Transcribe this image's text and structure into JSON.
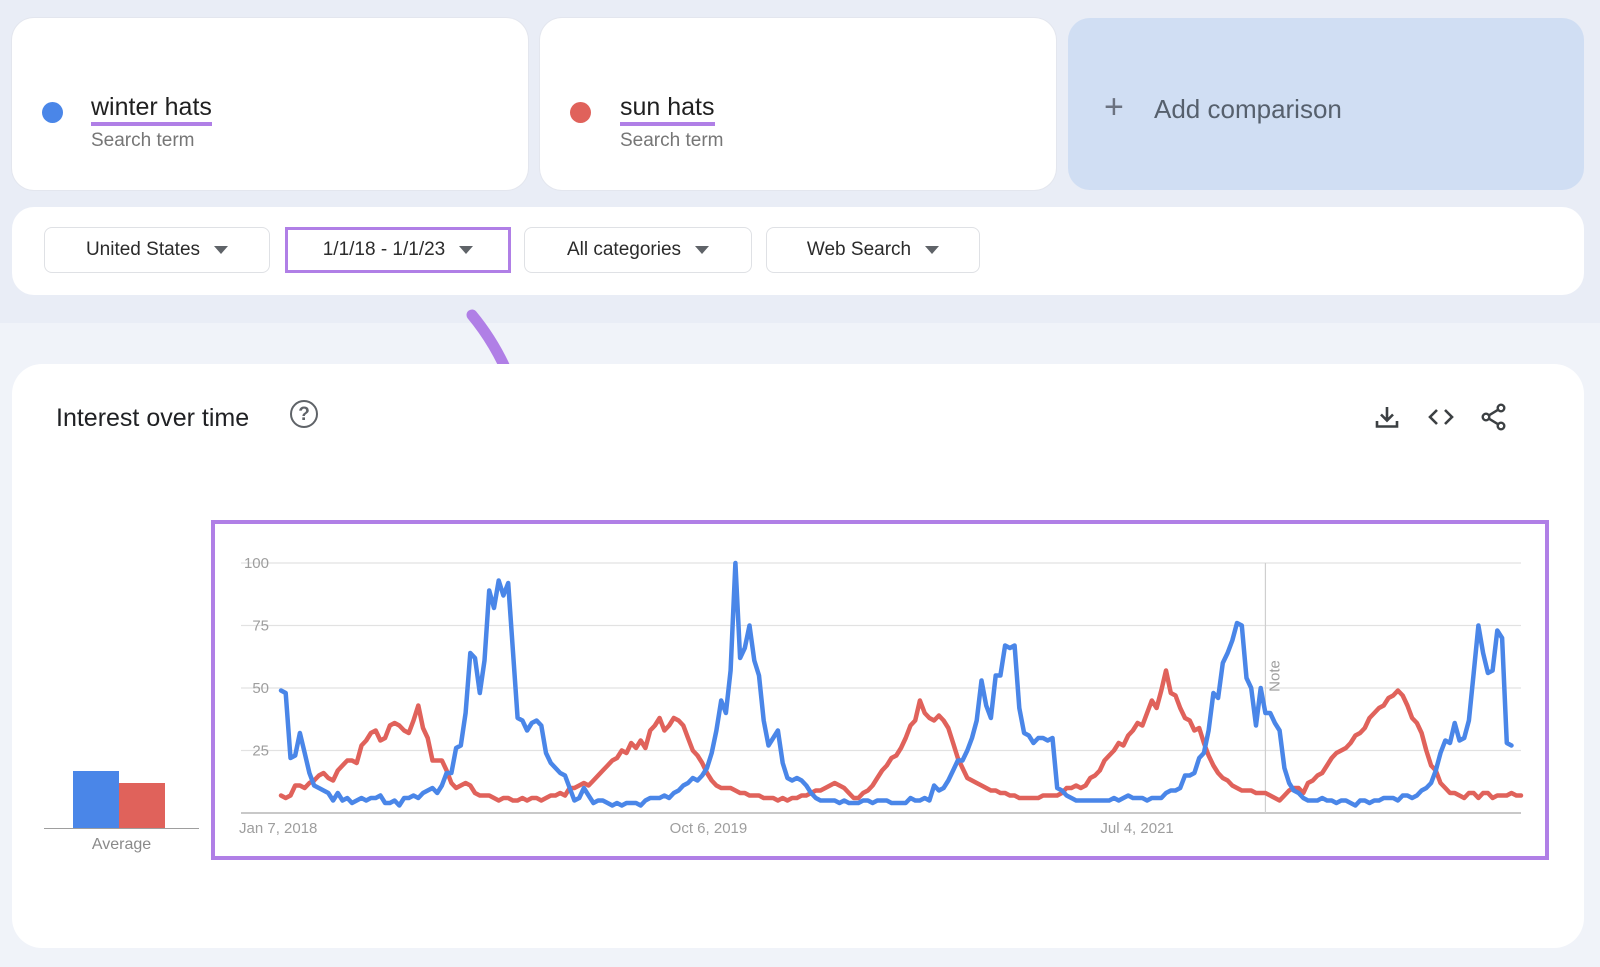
{
  "terms": [
    {
      "name": "winter hats",
      "subtitle": "Search term",
      "color": "#4a86e8"
    },
    {
      "name": "sun hats",
      "subtitle": "Search term",
      "color": "#e0625b"
    }
  ],
  "add_comparison": {
    "icon": "plus-icon",
    "label": "Add comparison"
  },
  "filters": [
    {
      "label": "United States",
      "highlighted": false
    },
    {
      "label": "1/1/18 - 1/1/23",
      "highlighted": true
    },
    {
      "label": "All categories",
      "highlighted": false
    },
    {
      "label": "Web Search",
      "highlighted": false
    }
  ],
  "highlight_color": "#b07fe6",
  "section": {
    "title": "Interest over time",
    "help_icon": "question-circle-icon",
    "actions": [
      {
        "icon": "download-icon"
      },
      {
        "icon": "embed-code-icon"
      },
      {
        "icon": "share-icon"
      }
    ]
  },
  "average": {
    "label": "Average",
    "values": [
      {
        "term": "winter hats",
        "value": 23
      },
      {
        "term": "sun hats",
        "value": 18
      }
    ]
  },
  "chart_data": {
    "type": "line",
    "title": "Interest over time",
    "xlabel": "",
    "ylabel": "",
    "ylim": [
      0,
      100
    ],
    "yticks": [
      25,
      50,
      75,
      100
    ],
    "xtick_labels": [
      {
        "label": "Jan 7, 2018",
        "week_index": 0
      },
      {
        "label": "Oct 6, 2019",
        "week_index": 91
      },
      {
        "label": "Jul 4, 2021",
        "week_index": 182
      }
    ],
    "note": {
      "label": "Note",
      "week_index": 208
    },
    "grid": true,
    "legend": "none",
    "x_start": "Jan 7, 2018",
    "x_interval": "weekly",
    "series": [
      {
        "name": "winter hats",
        "color": "#4a86e8",
        "values": [
          49,
          48,
          22,
          23,
          32,
          24,
          16,
          11,
          10,
          9,
          8,
          5,
          8,
          5,
          6,
          4,
          5,
          6,
          5,
          6,
          6,
          7,
          4,
          4,
          5,
          3,
          6,
          6,
          7,
          6,
          8,
          9,
          10,
          8,
          11,
          16,
          16,
          26,
          27,
          40,
          64,
          62,
          48,
          61,
          89,
          82,
          93,
          87,
          92,
          65,
          38,
          37,
          33,
          36,
          37,
          35,
          24,
          20,
          18,
          16,
          15,
          10,
          5,
          6,
          10,
          7,
          4,
          5,
          5,
          4,
          3,
          4,
          3,
          4,
          4,
          4,
          3,
          5,
          6,
          6,
          6,
          7,
          6,
          8,
          9,
          11,
          12,
          14,
          13,
          15,
          18,
          24,
          33,
          45,
          40,
          57,
          100,
          62,
          66,
          75,
          61,
          55,
          37,
          27,
          30,
          33,
          20,
          14,
          13,
          14,
          13,
          11,
          8,
          6,
          5,
          5,
          5,
          5,
          4,
          5,
          4,
          4,
          4,
          5,
          5,
          4,
          5,
          5,
          5,
          4,
          4,
          4,
          4,
          6,
          5,
          5,
          6,
          5,
          11,
          9,
          10,
          13,
          17,
          21,
          21,
          25,
          30,
          37,
          53,
          43,
          38,
          55,
          55,
          67,
          66,
          67,
          42,
          32,
          31,
          28,
          30,
          30,
          29,
          30,
          10,
          9,
          7,
          6,
          5,
          5,
          5,
          5,
          5,
          5,
          5,
          5,
          6,
          5,
          6,
          7,
          6,
          6,
          6,
          5,
          6,
          6,
          6,
          8,
          9,
          9,
          10,
          15,
          15,
          16,
          22,
          24,
          33,
          48,
          46,
          60,
          64,
          69,
          76,
          75,
          54,
          50,
          35,
          50,
          40,
          40,
          36,
          33,
          18,
          12,
          9,
          8,
          6,
          5,
          5,
          5,
          6,
          5,
          5,
          4,
          5,
          5,
          4,
          3,
          5,
          5,
          4,
          5,
          5,
          6,
          6,
          6,
          5,
          7,
          7,
          6,
          7,
          9,
          10,
          12,
          17,
          24,
          29,
          28,
          36,
          29,
          30,
          37,
          56,
          75,
          64,
          56,
          57,
          73,
          70,
          28,
          27
        ]
      },
      {
        "name": "sun hats",
        "color": "#e0625b",
        "values": [
          7,
          6,
          7,
          11,
          11,
          10,
          12,
          13,
          15,
          16,
          14,
          13,
          17,
          19,
          21,
          21,
          20,
          27,
          29,
          32,
          33,
          29,
          30,
          35,
          36,
          35,
          33,
          32,
          37,
          43,
          34,
          30,
          21,
          21,
          21,
          17,
          12,
          10,
          11,
          12,
          11,
          8,
          7,
          7,
          7,
          6,
          5,
          6,
          6,
          5,
          5,
          6,
          5,
          6,
          6,
          5,
          6,
          7,
          7,
          8,
          7,
          10,
          10,
          11,
          12,
          11,
          13,
          15,
          17,
          19,
          21,
          22,
          25,
          24,
          28,
          26,
          29,
          26,
          33,
          35,
          38,
          33,
          35,
          38,
          37,
          35,
          30,
          25,
          23,
          20,
          16,
          13,
          11,
          10,
          10,
          10,
          9,
          8,
          8,
          7,
          7,
          7,
          6,
          6,
          6,
          5,
          6,
          5,
          6,
          6,
          7,
          7,
          8,
          9,
          9,
          10,
          11,
          12,
          11,
          10,
          8,
          6,
          6,
          8,
          9,
          11,
          14,
          17,
          19,
          22,
          23,
          26,
          30,
          35,
          37,
          45,
          40,
          38,
          37,
          39,
          37,
          34,
          28,
          22,
          18,
          14,
          13,
          12,
          11,
          10,
          9,
          9,
          8,
          8,
          7,
          7,
          6,
          6,
          6,
          6,
          6,
          7,
          7,
          7,
          7,
          8,
          10,
          10,
          11,
          10,
          11,
          14,
          15,
          17,
          21,
          23,
          25,
          28,
          27,
          31,
          33,
          36,
          35,
          40,
          45,
          42,
          49,
          57,
          48,
          47,
          42,
          38,
          37,
          33,
          34,
          28,
          23,
          19,
          16,
          14,
          13,
          11,
          10,
          9,
          9,
          9,
          8,
          8,
          8,
          7,
          6,
          5,
          7,
          9,
          10,
          10,
          8,
          12,
          13,
          15,
          16,
          19,
          22,
          24,
          25,
          26,
          28,
          31,
          32,
          34,
          38,
          40,
          42,
          43,
          46,
          47,
          49,
          47,
          43,
          38,
          36,
          32,
          25,
          19,
          17,
          12,
          10,
          8,
          8,
          7,
          6,
          8,
          8,
          6,
          8,
          8,
          6,
          7,
          7,
          7,
          8,
          7,
          7
        ]
      }
    ]
  }
}
